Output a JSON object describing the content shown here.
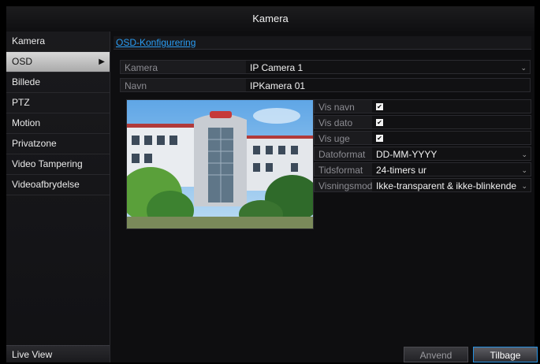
{
  "window": {
    "title": "Kamera"
  },
  "sidebar": {
    "items": [
      {
        "label": "Kamera"
      },
      {
        "label": "OSD",
        "active": true
      },
      {
        "label": "Billede"
      },
      {
        "label": "PTZ"
      },
      {
        "label": "Motion"
      },
      {
        "label": "Privatzone"
      },
      {
        "label": "Video Tampering"
      },
      {
        "label": "Videoafbrydelse"
      }
    ],
    "bottom": "Live View"
  },
  "main": {
    "section_title": "OSD-Konfigurering",
    "camera": {
      "label": "Kamera",
      "value": "IP Camera 1"
    },
    "name": {
      "label": "Navn",
      "value": "IPKamera 01"
    },
    "options": {
      "show_name": {
        "label": "Vis navn",
        "checked": true
      },
      "show_date": {
        "label": "Vis dato",
        "checked": true
      },
      "show_week": {
        "label": "Vis uge",
        "checked": true
      },
      "date_format": {
        "label": "Datoformat",
        "value": "DD-MM-YYYY"
      },
      "time_format": {
        "label": "Tidsformat",
        "value": "24-timers ur"
      },
      "display_mode": {
        "label": "Visningsmodus",
        "value": "Ikke-transparent & ikke-blinkende"
      }
    },
    "buttons": {
      "apply": "Anvend",
      "back": "Tilbage"
    }
  },
  "colors": {
    "accent": "#2a9df4",
    "active_tab": "#c4c4c4",
    "background": "#0e0e10"
  },
  "icons": {
    "checkbox": "checkbox-checked-icon",
    "dropdown": "chevron-down-icon",
    "submenu": "chevron-right-icon"
  }
}
